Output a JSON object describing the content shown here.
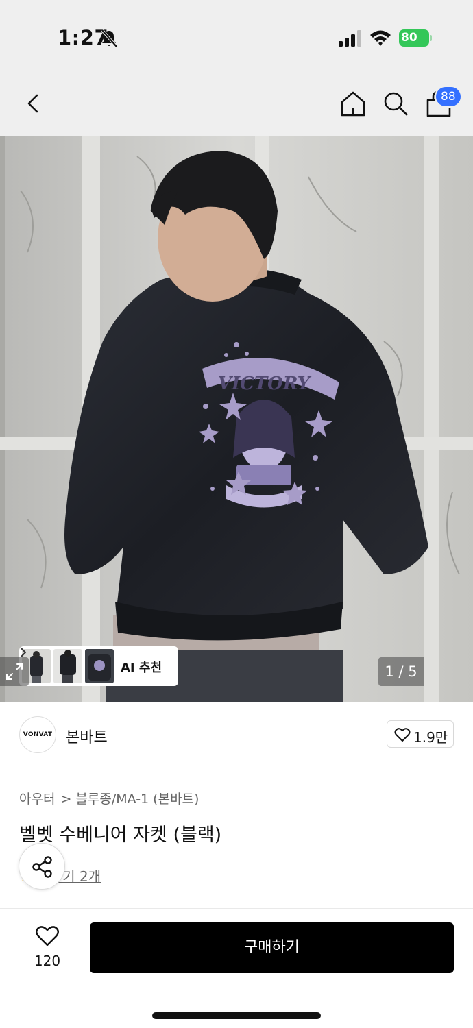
{
  "status_bar": {
    "time": "1:27",
    "battery_level": "80",
    "icons": [
      "bell-slash-icon",
      "signal-icon",
      "wifi-icon",
      "battery-charging-icon"
    ]
  },
  "header": {
    "icons": [
      "chevron-left-icon",
      "home-icon",
      "search-icon",
      "shopping-bag-icon"
    ],
    "cart_badge": "88",
    "badge_color": "#3470ff",
    "background": "#efefef"
  },
  "hero": {
    "ai_recommend_label": "AI 추천",
    "page_indicator": "1 / 5",
    "current_page": 1,
    "total_pages": 5
  },
  "brand": {
    "logo_text": "VONVAT",
    "name": "본바트",
    "like_count": "1.9만"
  },
  "product": {
    "breadcrumb": [
      "아우터",
      "블루종/MA-1 (본바트)"
    ],
    "title": "벨벳 수베니어 자켓 (블랙)",
    "review_text": "-기 2개",
    "review_star_color": "#ffb400"
  },
  "bottom_bar": {
    "wishlist_count": "120",
    "buy_label": "구매하기",
    "buy_color": "#000000"
  }
}
